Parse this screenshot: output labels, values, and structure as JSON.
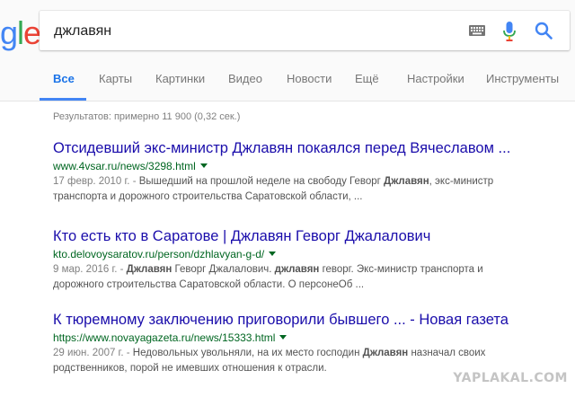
{
  "logo": {
    "g": "g",
    "l": "l",
    "e": "e"
  },
  "search": {
    "query": "джлавян"
  },
  "icons": {
    "keyboard": "keyboard-icon",
    "mic": "mic-icon",
    "search": "search-icon"
  },
  "tabs": [
    {
      "label": "Все"
    },
    {
      "label": "Карты"
    },
    {
      "label": "Картинки"
    },
    {
      "label": "Видео"
    },
    {
      "label": "Новости"
    },
    {
      "label": "Ещё"
    },
    {
      "label": "Настройки"
    },
    {
      "label": "Инструменты"
    }
  ],
  "stats": "Результатов: примерно 11 900 (0,32 сек.)",
  "results": [
    {
      "title": "Отсидевший экс-министр Джлавян покаялся перед Вячеславом ...",
      "url": "www.4vsar.ru/news/3298.html",
      "date": "17 февр. 2010 г. - ",
      "line1_a": "Вышедший на прошлой неделе на свободу Геворг ",
      "line1_b": "Джлавян",
      "line1_c": ", экс-министр",
      "line2": "транспорта и дорожного строительства Саратовской области, ..."
    },
    {
      "title": "Кто есть кто в Саратове | Джлавян Геворг Джалалович",
      "url": "kto.delovoysaratov.ru/person/dzhlavyan-g-d/",
      "date": "9 мар. 2016 г. - ",
      "line1_a": "Джлавян",
      "line1_b": " Геворг Джалалович. ",
      "line1_c": "джлавян",
      "line1_d": " геворг. Экс-министр транспорта и",
      "line2": "дорожного строительства Саратовской области. О персонеОб ..."
    },
    {
      "title": "К тюремному заключению приговорили бывшего ... - Новая газета",
      "url": "https://www.novayagazeta.ru/news/15333.html",
      "date": "29 июн. 2007 г. - ",
      "line1_a": "Недовольных увольняли, на их место господин ",
      "line1_b": "Джлавян",
      "line1_c": " назначал своих",
      "line2": "родственников, порой не имевших отношения к отрасли."
    }
  ],
  "colors": {
    "link": "#1a0dab",
    "url": "#006621",
    "accent": "#4285f4"
  },
  "watermark": "YAPLAKAL.COM"
}
